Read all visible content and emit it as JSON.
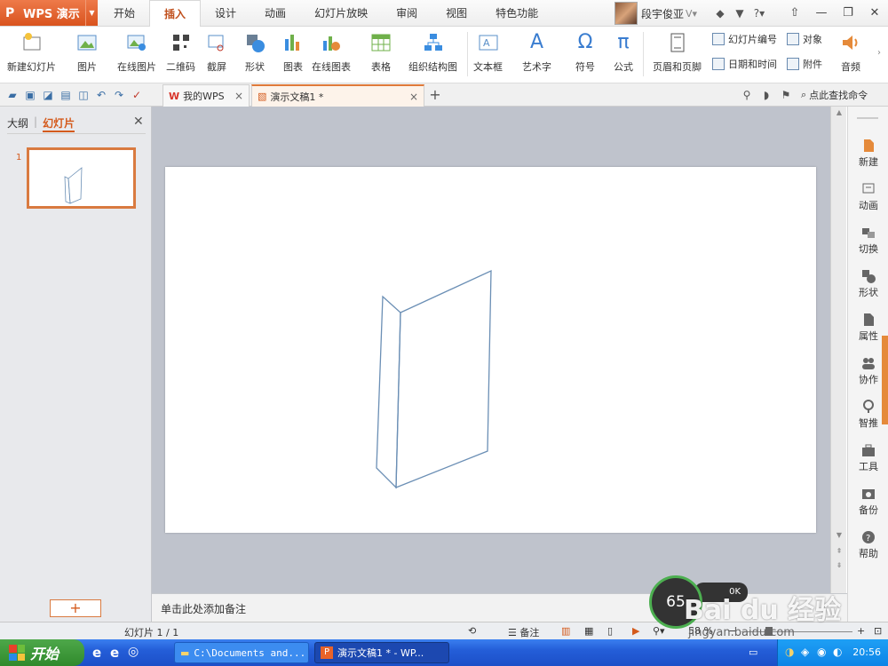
{
  "app": {
    "name": "WPS 演示"
  },
  "menu_tabs": [
    {
      "label": "开始"
    },
    {
      "label": "插入"
    },
    {
      "label": "设计"
    },
    {
      "label": "动画"
    },
    {
      "label": "幻灯片放映"
    },
    {
      "label": "审阅"
    },
    {
      "label": "视图"
    },
    {
      "label": "特色功能"
    }
  ],
  "active_tab_index": 1,
  "user": {
    "name": "段宇俊亚"
  },
  "ribbon": {
    "new_slide": "新建幻灯片",
    "picture": "图片",
    "online_picture": "在线图片",
    "qrcode": "二维码",
    "screenshot": "截屏",
    "shape": "形状",
    "chart": "图表",
    "online_chart": "在线图表",
    "table": "表格",
    "org_chart": "组织结构图",
    "textbox": "文本框",
    "wordart": "艺术字",
    "symbol": "符号",
    "formula": "公式",
    "header_footer": "页眉和页脚",
    "slide_number": "幻灯片编号",
    "object": "对象",
    "date_time": "日期和时间",
    "attachment": "附件",
    "audio": "音频",
    "symbol_glyph": "Ω",
    "formula_glyph": "π",
    "wordart_glyph": "A"
  },
  "doc_tabs": [
    {
      "label": "我的WPS"
    },
    {
      "label": "演示文稿1 *"
    }
  ],
  "search_cmd": "点此查找命令",
  "left_panel": {
    "outline_tab": "大纲",
    "slides_tab": "幻灯片",
    "slide_number": "1"
  },
  "notes_placeholder": "单击此处添加备注",
  "right_panel": [
    {
      "label": "新建",
      "icon": "new-icon"
    },
    {
      "label": "动画",
      "icon": "animation-icon"
    },
    {
      "label": "切换",
      "icon": "transition-icon"
    },
    {
      "label": "形状",
      "icon": "shape-icon"
    },
    {
      "label": "属性",
      "icon": "properties-icon"
    },
    {
      "label": "协作",
      "icon": "collaborate-icon"
    },
    {
      "label": "智推",
      "icon": "smart-icon"
    },
    {
      "label": "工具",
      "icon": "toolbox-icon"
    },
    {
      "label": "备份",
      "icon": "backup-icon"
    },
    {
      "label": "帮助",
      "icon": "help-icon"
    }
  ],
  "status": {
    "slide_info": "幻灯片 1 / 1",
    "notes_btn": "备注",
    "zoom": "58 %"
  },
  "overlay": {
    "speed": "65",
    "speed_small": "0K",
    "watermark": "Bai du 经验",
    "watermark_url": "jingyan.baidu.com"
  },
  "taskbar": {
    "start": "开始",
    "task1": "C:\\Documents and...",
    "task2": "演示文稿1 * - WP...",
    "clock": "20:56"
  },
  "colors": {
    "accent": "#d45a1c",
    "shape_stroke": "#6b8fb5"
  }
}
